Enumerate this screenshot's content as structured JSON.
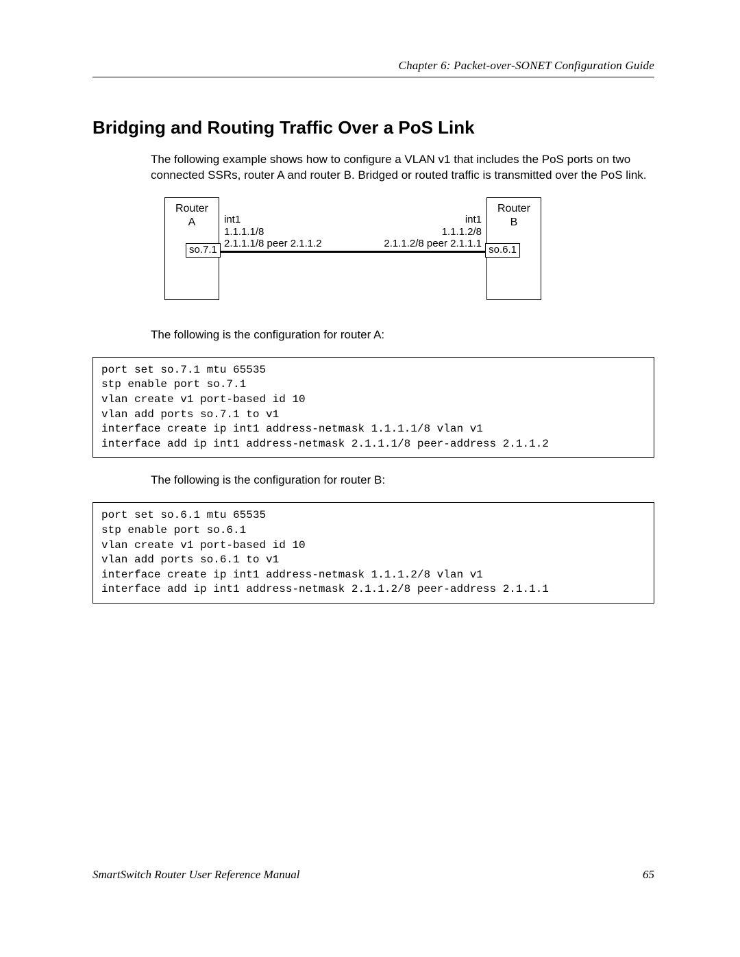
{
  "header": {
    "running_head": "Chapter 6: Packet-over-SONET Configuration Guide"
  },
  "section": {
    "title": "Bridging and Routing Traffic Over a PoS Link",
    "intro": "The following example shows how to configure a VLAN  v1  that includes the PoS ports on two connected SSRs, router A and router B.  Bridged or routed traffic is transmitted over the PoS link.",
    "config_a_caption": "The following is the configuration for router A:",
    "config_b_caption": "The following is the configuration for router B:"
  },
  "diagram": {
    "router_a": {
      "name": "Router",
      "id": "A",
      "port": "so.7.1"
    },
    "router_b": {
      "name": "Router",
      "id": "B",
      "port": "so.6.1"
    },
    "left": {
      "int": "int1",
      "addr": "1.1.1.1/8",
      "peer": "2.1.1.1/8 peer 2.1.1.2"
    },
    "right": {
      "int": "int1",
      "addr": "1.1.1.2/8",
      "peer": "2.1.1.2/8 peer 2.1.1.1"
    }
  },
  "code": {
    "router_a": "port set so.7.1 mtu 65535\nstp enable port so.7.1\nvlan create v1 port-based id 10\nvlan add ports so.7.1 to v1\ninterface create ip int1 address-netmask 1.1.1.1/8 vlan v1\ninterface add ip int1 address-netmask 2.1.1.1/8 peer-address 2.1.1.2",
    "router_b": "port set so.6.1 mtu 65535\nstp enable port so.6.1\nvlan create v1 port-based id 10\nvlan add ports so.6.1 to v1\ninterface create ip int1 address-netmask 1.1.1.2/8 vlan v1\ninterface add ip int1 address-netmask 2.1.1.2/8 peer-address 2.1.1.1"
  },
  "footer": {
    "manual_title": "SmartSwitch Router User Reference Manual",
    "page_number": "65"
  }
}
